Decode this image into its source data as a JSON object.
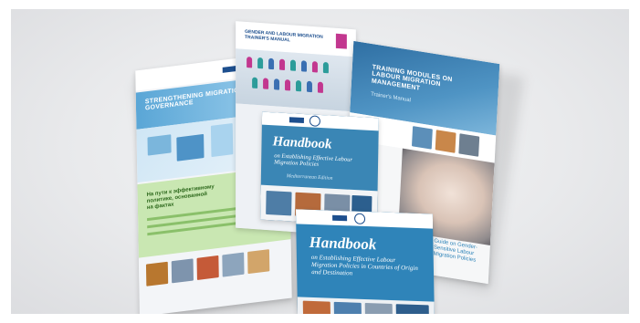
{
  "book_strengthening": {
    "title": "STRENGTHENING MIGRATION GOVERNANCE",
    "subtitle_line1": "На пути к эффективному",
    "subtitle_line2": "политике, основанной",
    "subtitle_line3": "на фактах"
  },
  "book_trainer_manual": {
    "header": "GENDER AND LABOUR MIGRATION TRAINER'S MANUAL"
  },
  "book_training_modules": {
    "title": "TRAINING MODULES ON LABOUR MIGRATION MANAGEMENT",
    "subtitle": "Trainer's Manual",
    "guide_title": "Guide on Gender-Sensitive Labour Migration Policies"
  },
  "book_handbook_small": {
    "title": "Handbook",
    "subtitle": "on Establishing Effective Labour Migration Policies",
    "edition": "Mediterranean Edition"
  },
  "book_handbook_large": {
    "title": "Handbook",
    "subtitle": "on Establishing Effective Labour Migration Policies in Countries of Origin and Destination"
  },
  "colors": {
    "background": "#e9eaec",
    "cover_blue": "#2f84b9",
    "navy": "#1d4f8e",
    "green_panel": "#c9e7b2",
    "magenta": "#c2378f"
  }
}
